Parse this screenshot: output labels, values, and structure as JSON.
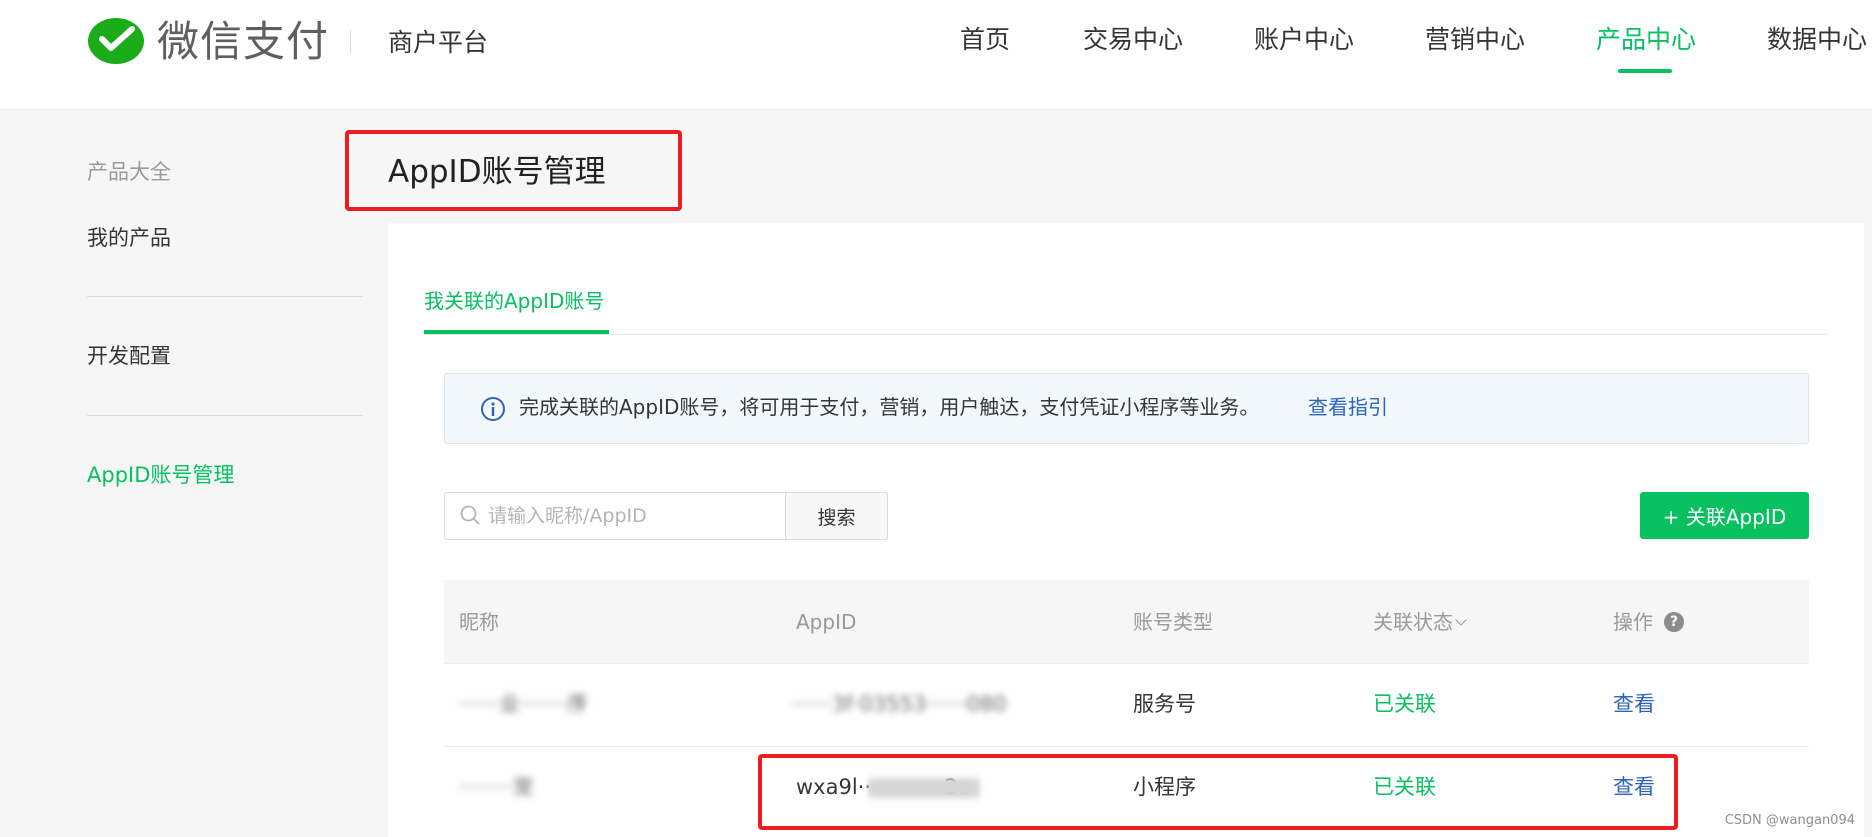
{
  "header": {
    "brand": "微信支付",
    "platform": "商户平台",
    "nav": [
      "首页",
      "交易中心",
      "账户中心",
      "营销中心",
      "产品中心",
      "数据中心"
    ],
    "active_nav": "产品中心",
    "accent_color": "#07c160"
  },
  "sidebar": {
    "title": "产品大全",
    "items": [
      {
        "label": "我的产品"
      },
      {
        "label": "开发配置"
      },
      {
        "label": "AppID账号管理",
        "active": true
      }
    ]
  },
  "page": {
    "title": "AppID账号管理",
    "tab": "我关联的AppID账号",
    "banner": {
      "text": "完成关联的AppID账号，将可用于支付，营销，用户触达，支付凭证小程序等业务。",
      "link": "查看指引",
      "icon": "info-icon"
    },
    "search": {
      "placeholder": "请输入昵称/AppID",
      "value": "",
      "button": "搜索",
      "icon": "search-icon"
    },
    "add_button": "+ 关联AppID"
  },
  "table": {
    "columns": [
      "昵称",
      "AppID",
      "账号类型",
      "关联状态",
      "操作"
    ],
    "rows": [
      {
        "nickname": "······业·······序",
        "appid": "······3f·03553······080",
        "type": "服务号",
        "status": "已关联",
        "action": "查看"
      },
      {
        "nickname": "········宠",
        "appid": "wxa9l·············2c",
        "type": "小程序",
        "status": "已关联",
        "action": "查看"
      }
    ]
  },
  "watermark": "CSDN @wangan094"
}
